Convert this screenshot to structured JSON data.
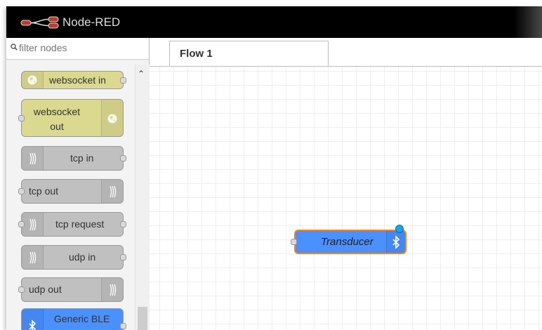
{
  "app": {
    "title": "Node-RED"
  },
  "palette": {
    "filter_placeholder": "filter nodes",
    "nodes": [
      {
        "label": "websocket in",
        "category": "input"
      },
      {
        "label": "websocket\nout",
        "category": "output"
      },
      {
        "label": "tcp in",
        "category": "input"
      },
      {
        "label": "tcp out",
        "category": "output"
      },
      {
        "label": "tcp request",
        "category": "function"
      },
      {
        "label": "udp in",
        "category": "input"
      },
      {
        "label": "udp out",
        "category": "output"
      },
      {
        "label": "Generic BLE",
        "category": "input"
      }
    ]
  },
  "tabs": [
    {
      "label": "Flow 1",
      "active": true
    }
  ],
  "workspace": {
    "nodes": [
      {
        "label": "Transducer",
        "icon": "bluetooth-icon"
      }
    ]
  },
  "colors": {
    "header": "#000000",
    "websocket_node": "#dbd98f",
    "tcp_node": "#c0c0c0",
    "ble_node": "#4a90ff",
    "selected_outline": "#ff7f0e",
    "status_dot": "#1aa3e8"
  }
}
